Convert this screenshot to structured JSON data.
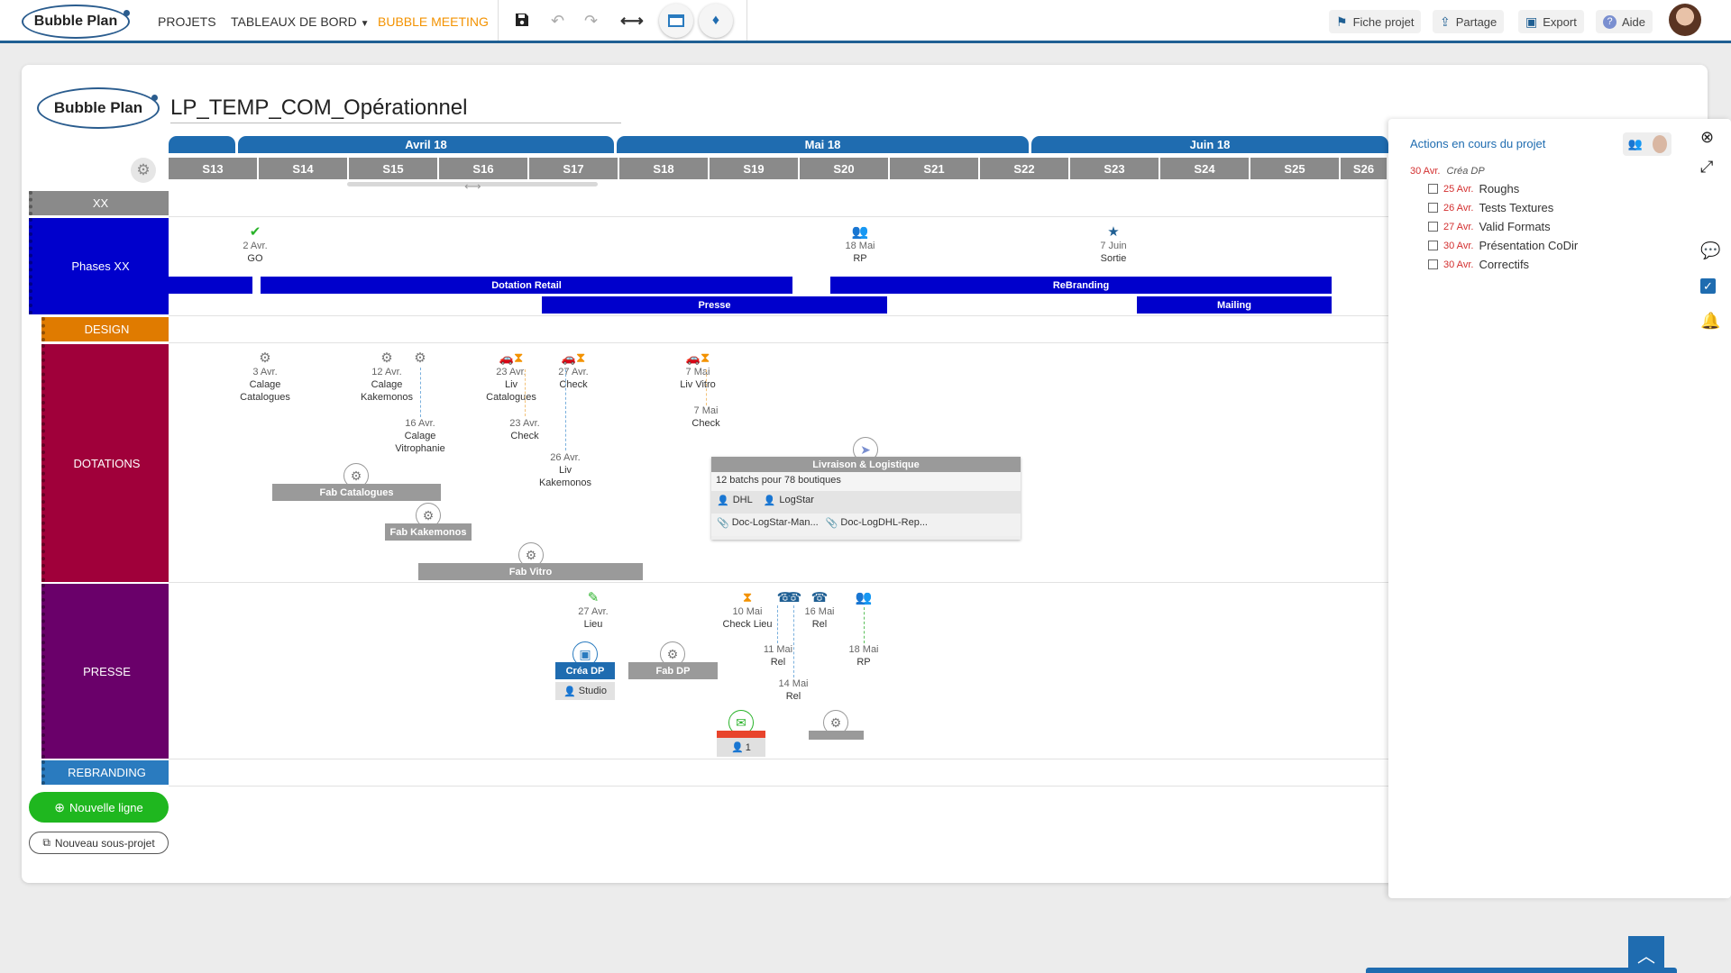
{
  "topbar": {
    "logo_text": "Bubble Plan",
    "nav": {
      "projets": "PROJETS",
      "tableaux": "TABLEAUX DE BORD",
      "meeting": "BUBBLE MEETING"
    },
    "right": {
      "fiche": "Fiche projet",
      "partage": "Partage",
      "export": "Export",
      "aide": "Aide"
    }
  },
  "project": {
    "logo_text": "Bubble Plan",
    "title": "LP_TEMP_COM_Opérationnel"
  },
  "timeline": {
    "months": [
      "Avril 18",
      "Mai 18",
      "Juin 18"
    ],
    "weeks": [
      "S13",
      "S14",
      "S15",
      "S16",
      "S17",
      "S18",
      "S19",
      "S20",
      "S21",
      "S22",
      "S23",
      "S24",
      "S25",
      "S26"
    ]
  },
  "rows": {
    "xx": "XX",
    "phases": "Phases XX",
    "design": "DESIGN",
    "dotations": "DOTATIONS",
    "presse": "PRESSE",
    "rebranding": "REBRANDING"
  },
  "phases": {
    "milestones": [
      {
        "date": "2 Avr.",
        "label": "GO"
      },
      {
        "date": "18 Mai",
        "label": "RP"
      },
      {
        "date": "7 Juin",
        "label": "Sortie"
      }
    ],
    "bars": {
      "dotation": "Dotation Retail",
      "rebranding": "ReBranding",
      "presse": "Presse",
      "mailing": "Mailing"
    }
  },
  "dotations": {
    "m1": {
      "date": "3 Avr.",
      "l1": "Calage",
      "l2": "Catalogues"
    },
    "m2": {
      "date": "12 Avr.",
      "l1": "Calage",
      "l2": "Kakemonos"
    },
    "m3": {
      "date": "16 Avr.",
      "l1": "Calage",
      "l2": "Vitrophanie"
    },
    "m4": {
      "date": "23 Avr.",
      "l1": "Liv",
      "l2": "Catalogues"
    },
    "m5": {
      "date": "27 Avr.",
      "l1": "Check"
    },
    "m6": {
      "date": "23 Avr.",
      "l1": "Check"
    },
    "m7": {
      "date": "26 Avr.",
      "l1": "Liv",
      "l2": "Kakemonos"
    },
    "m8": {
      "date": "7 Mai",
      "l1": "Liv Vitro"
    },
    "m9": {
      "date": "7 Mai",
      "l1": "Check"
    },
    "bars": {
      "fab_cat": "Fab Catalogues",
      "fab_kak": "Fab Kakemonos",
      "fab_vitro": "Fab Vitro"
    },
    "card": {
      "title": "Livraison & Logistique",
      "desc": "12 batchs pour 78 boutiques",
      "p1": "DHL",
      "p2": "LogStar",
      "doc1": "Doc-LogStar-Man...",
      "doc2": "Doc-LogDHL-Rep..."
    }
  },
  "presse": {
    "m1": {
      "date": "27 Avr.",
      "l1": "Lieu"
    },
    "m2": {
      "date": "10 Mai",
      "l1": "Check Lieu"
    },
    "m3": {
      "date": "16 Mai",
      "l1": "Rel"
    },
    "m4": {
      "date": "11 Mai",
      "l1": "Rel"
    },
    "m5": {
      "date": "14 Mai",
      "l1": "Rel"
    },
    "m6": {
      "date": "18 Mai",
      "l1": "RP"
    },
    "crea_dp": "Créa DP",
    "studio": "Studio",
    "fab_dp": "Fab DP",
    "count": "1"
  },
  "buttons": {
    "nouvelle_ligne": "Nouvelle ligne",
    "nouveau_sous_projet": "Nouveau sous-projet"
  },
  "side": {
    "title": "Actions en cours du projet",
    "head_date": "30 Avr.",
    "head_label": "Créa DP",
    "items": [
      {
        "date": "25 Avr.",
        "label": "Roughs"
      },
      {
        "date": "26 Avr.",
        "label": "Tests Textures"
      },
      {
        "date": "27 Avr.",
        "label": "Valid Formats"
      },
      {
        "date": "30 Avr.",
        "label": "Présentation CoDir"
      },
      {
        "date": "30 Avr.",
        "label": "Correctifs"
      }
    ]
  },
  "colors": {
    "primary": "#1f6cb0",
    "phases": "#0000cc",
    "design": "#e07b00",
    "dotations": "#a0003a",
    "presse": "#6a006a",
    "rebranding": "#2a7bbf",
    "accent": "#f39200"
  }
}
